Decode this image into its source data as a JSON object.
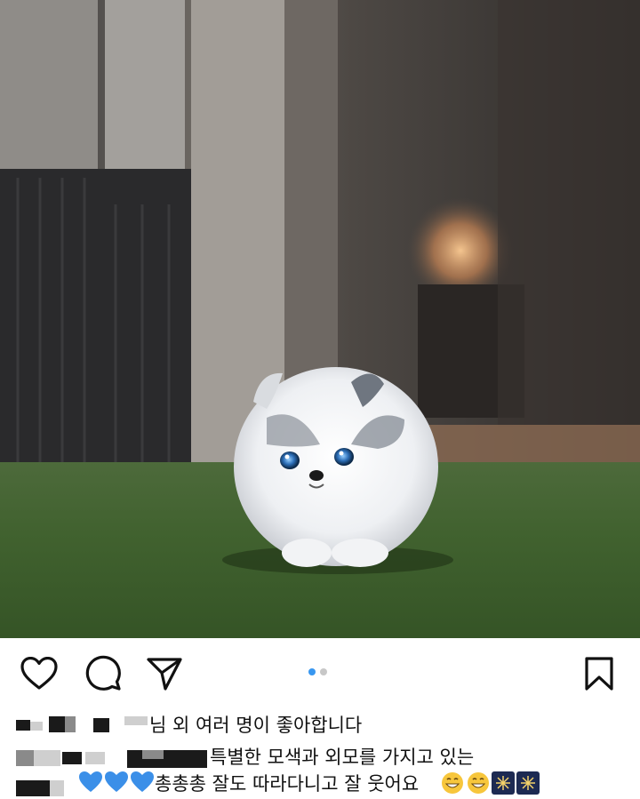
{
  "post": {
    "image_alt": "blue-eyed white and grey Pomeranian puppy walking on artificial grass",
    "carousel": {
      "count": 2,
      "current": 1
    }
  },
  "icons": {
    "like": "heart-outline-icon",
    "comment": "comment-bubble-icon",
    "share": "paper-plane-icon",
    "save": "bookmark-outline-icon"
  },
  "likes_text": "님 외 여러 명이 좋아합니다",
  "caption": {
    "line1": "특별한 모색과 외모를 가지고 있는",
    "line2": "총총총 잘도 따라다니고 잘 웃어요"
  },
  "colors": {
    "active_dot": "#3897f0",
    "inactive_dot": "#c7c7c7",
    "heart_emoji": "#3b8fe8"
  }
}
